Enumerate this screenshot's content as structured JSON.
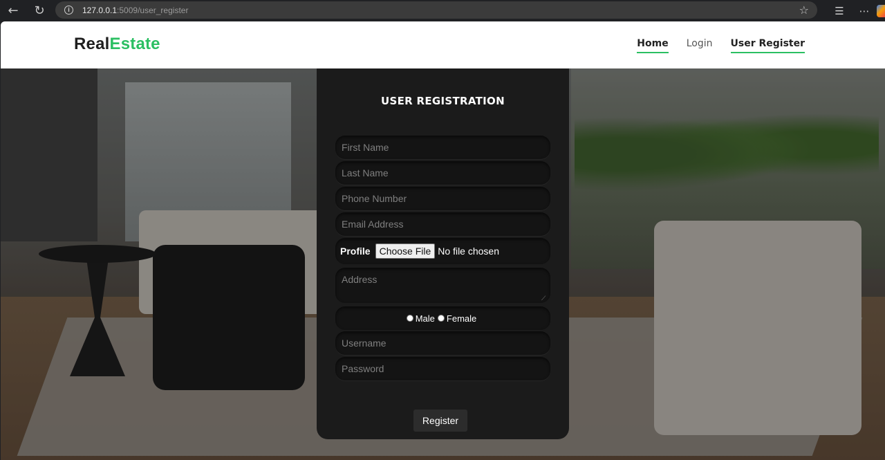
{
  "browser": {
    "url_host": "127.0.0.1",
    "url_rest": ":5009/user_register",
    "icons": [
      "back-arrow-icon",
      "reload-icon",
      "info-icon",
      "star-icon",
      "favorites-icon",
      "more-icon",
      "copilot-icon"
    ]
  },
  "header": {
    "logo_part1": "Real",
    "logo_part2": "Estate",
    "nav": {
      "home": "Home",
      "login": "Login",
      "user_register": "User Register"
    }
  },
  "form": {
    "title": "USER REGISTRATION",
    "first_name_placeholder": "First Name",
    "last_name_placeholder": "Last Name",
    "phone_placeholder": "Phone Number",
    "email_placeholder": "Email Address",
    "profile_label": "Profile",
    "choose_file_label": "Choose File",
    "file_status": "No file chosen",
    "address_placeholder": "Address",
    "gender_male": "Male",
    "gender_female": "Female",
    "username_placeholder": "Username",
    "password_placeholder": "Password",
    "register_label": "Register"
  },
  "colors": {
    "accent": "#2bbf62",
    "card_bg": "#1b1b1b",
    "field_bg": "#141414"
  }
}
